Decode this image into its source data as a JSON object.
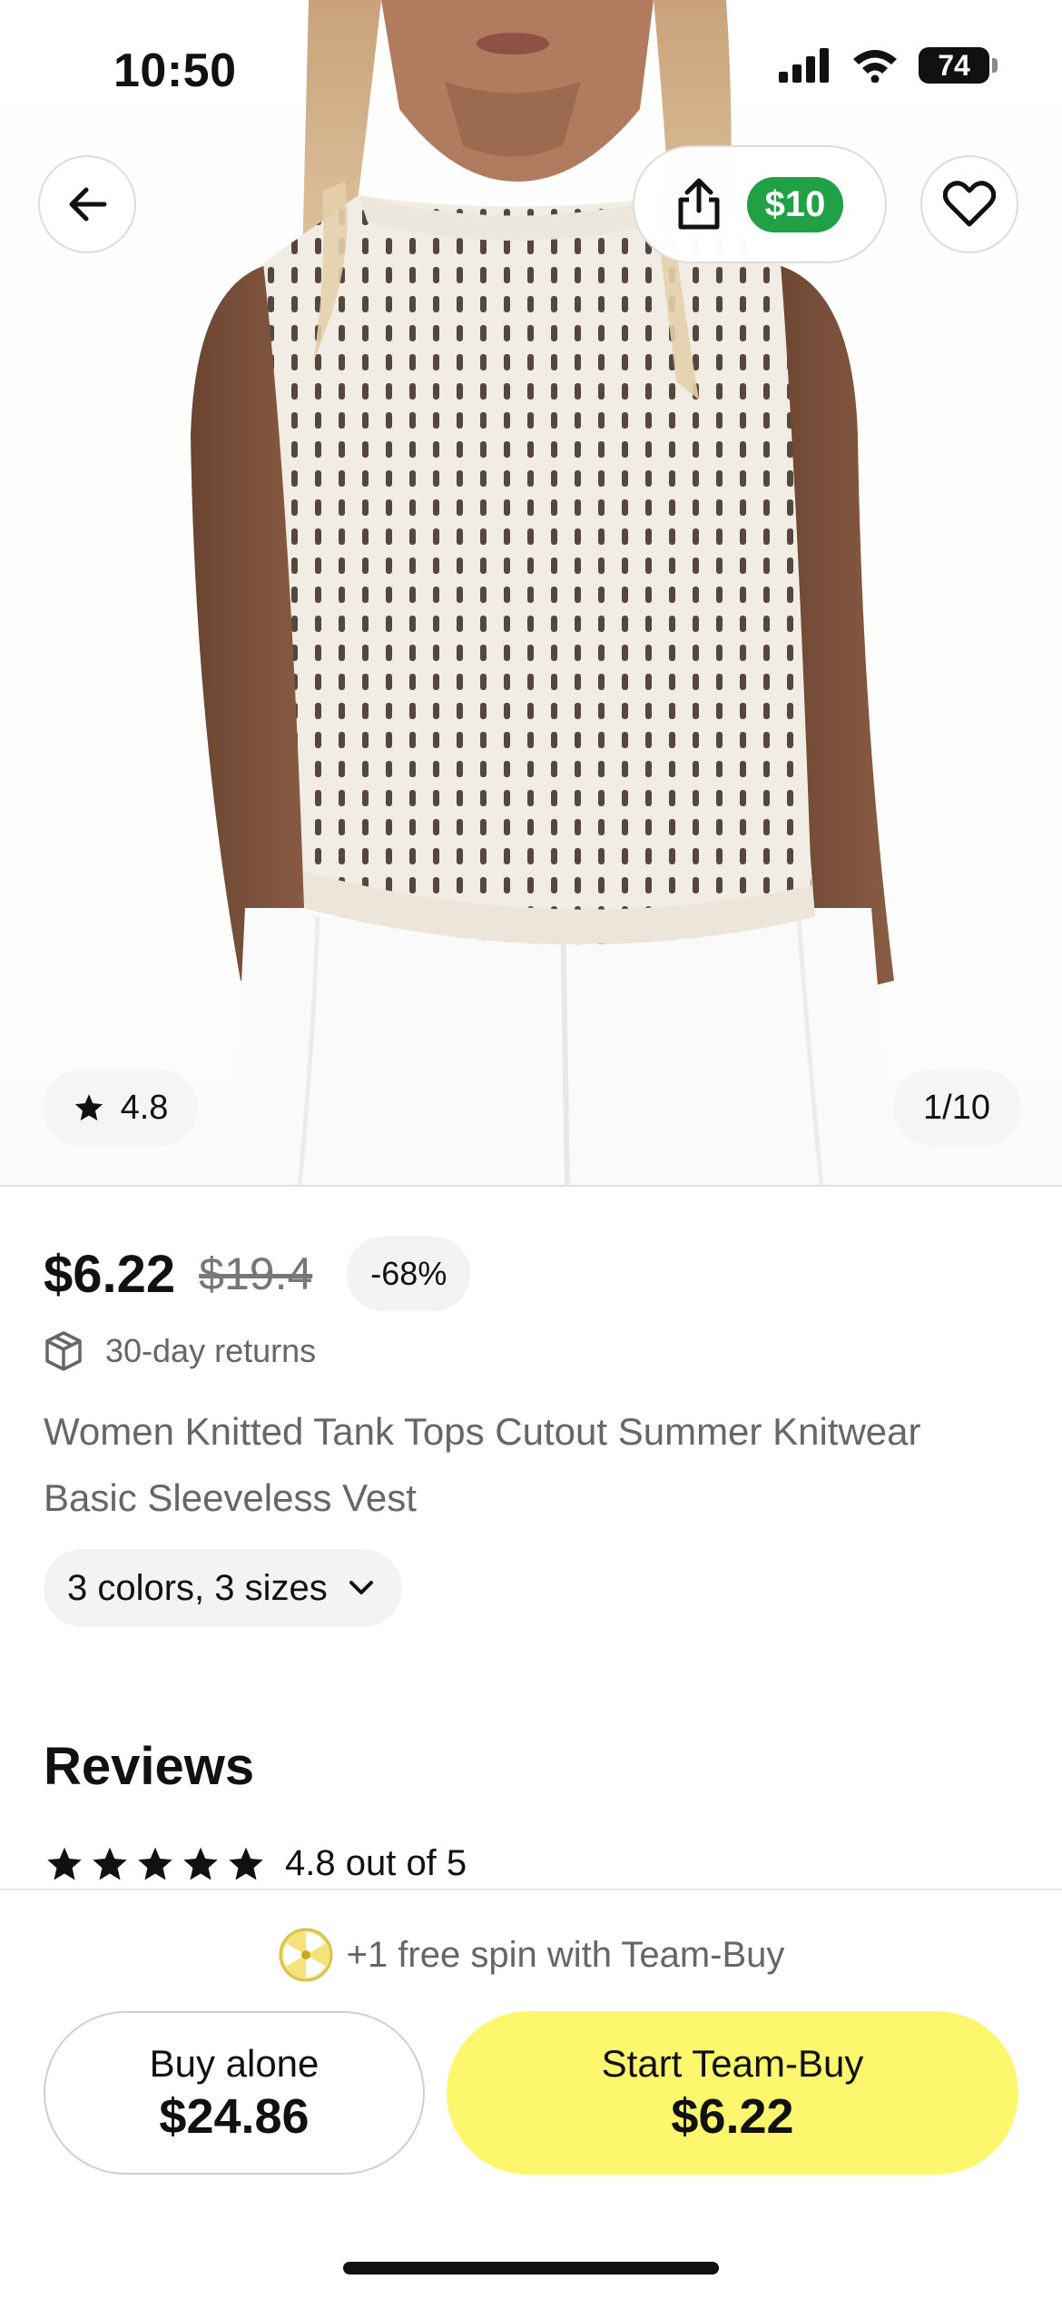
{
  "status_bar": {
    "time": "10:50",
    "battery": "74",
    "icons": [
      "signal-icon",
      "wifi-icon",
      "battery-icon"
    ]
  },
  "header": {
    "back_icon": "arrow-left-icon",
    "share_icon": "share-icon",
    "share_reward": "$10",
    "favorite_icon": "heart-icon"
  },
  "gallery": {
    "rating": "4.8",
    "counter": "1/10",
    "image_description_icon": "product-photo"
  },
  "product": {
    "price": "$6.22",
    "original_price": "$19.4",
    "discount": "-68%",
    "returns_label": "30-day returns",
    "title": "Women Knitted Tank Tops Cutout Summer Knitwear Basic Sleeveless Vest",
    "variants_label": "3 colors, 3 sizes"
  },
  "reviews": {
    "heading": "Reviews",
    "stars": 5,
    "summary": "4.8 out of 5"
  },
  "bottom_bar": {
    "promo_text": "+1 free spin with Team-Buy",
    "buy_alone": {
      "label": "Buy alone",
      "price": "$24.86"
    },
    "team_buy": {
      "label": "Start Team-Buy",
      "price": "$6.22"
    }
  },
  "colors": {
    "accent_green": "#22a045",
    "team_buy_yellow": "#fdf76d",
    "muted_text": "#666666"
  }
}
